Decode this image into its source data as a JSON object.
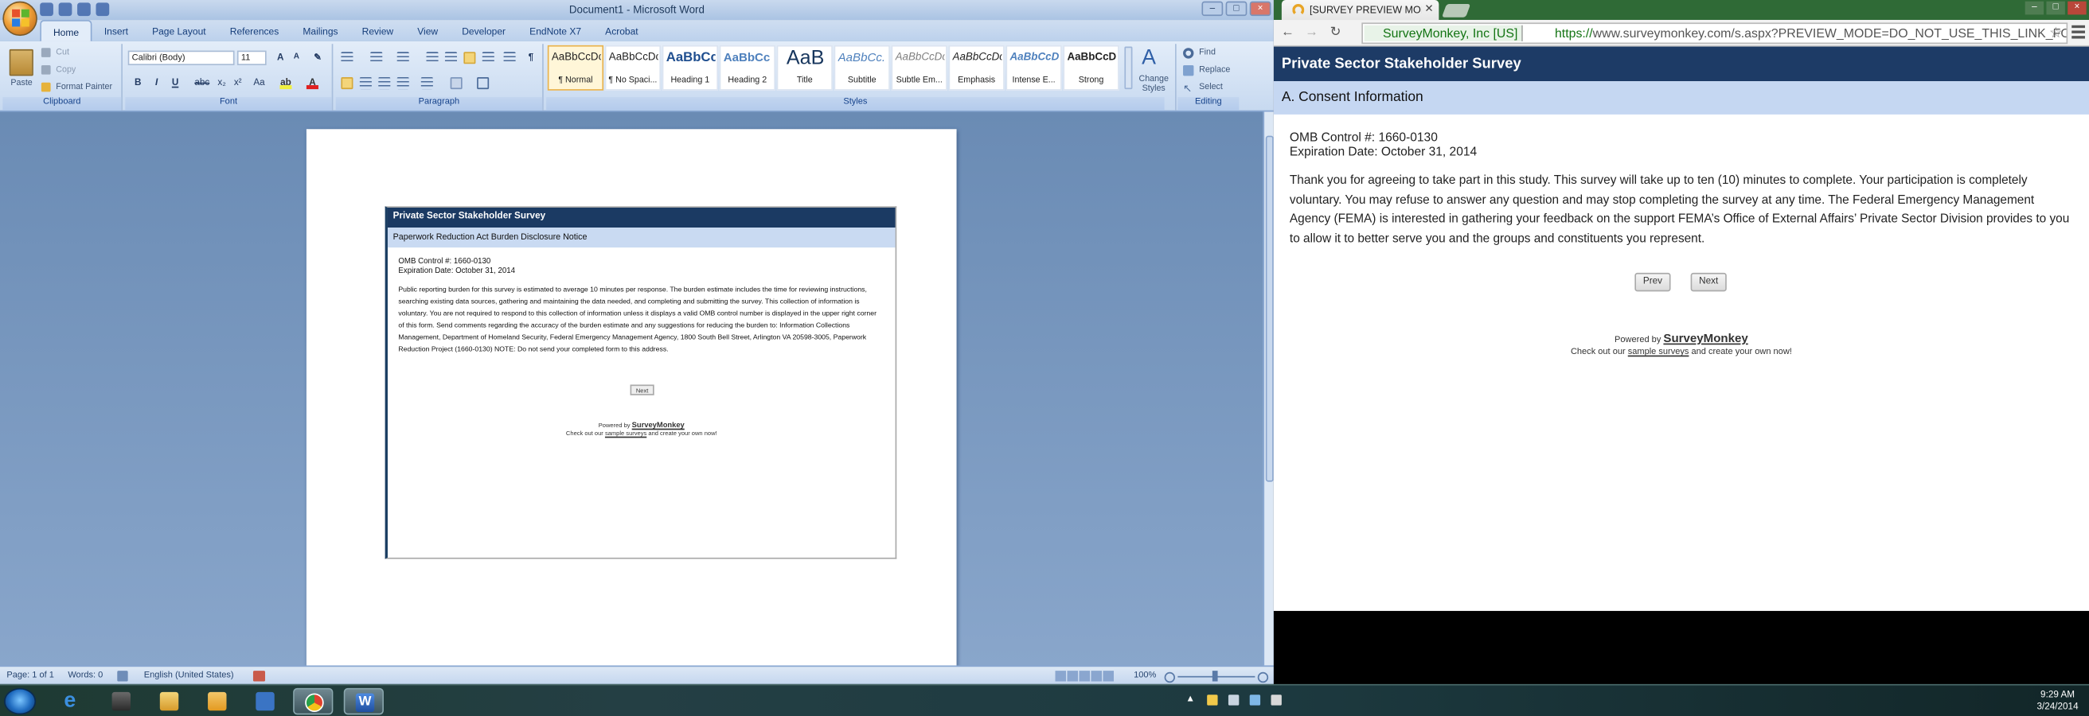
{
  "word": {
    "window_title": "Document1 - Microsoft Word",
    "tabs": [
      "Home",
      "Insert",
      "Page Layout",
      "References",
      "Mailings",
      "Review",
      "View",
      "Developer",
      "EndNote X7",
      "Acrobat"
    ],
    "clipboard": {
      "paste": "Paste",
      "cut": "Cut",
      "copy": "Copy",
      "format_painter": "Format Painter",
      "label": "Clipboard"
    },
    "font": {
      "name": "Calibri (Body)",
      "size": "11",
      "label": "Font"
    },
    "paragraph": {
      "label": "Paragraph"
    },
    "styles": {
      "label": "Styles",
      "items": [
        {
          "preview": "AaBbCcDc",
          "name": "¶ Normal"
        },
        {
          "preview": "AaBbCcDc",
          "name": "¶ No Spaci..."
        },
        {
          "preview": "AaBbCc",
          "name": "Heading 1"
        },
        {
          "preview": "AaBbCc",
          "name": "Heading 2"
        },
        {
          "preview": "AaB",
          "name": "Title"
        },
        {
          "preview": "AaBbCc.",
          "name": "Subtitle"
        },
        {
          "preview": "AaBbCcDc",
          "name": "Subtle Em..."
        },
        {
          "preview": "AaBbCcDc",
          "name": "Emphasis"
        },
        {
          "preview": "AaBbCcDc",
          "name": "Intense E..."
        },
        {
          "preview": "AaBbCcDc",
          "name": "Strong"
        }
      ],
      "change_styles": "Change Styles"
    },
    "editing": {
      "find": "Find",
      "replace": "Replace",
      "select": "Select",
      "label": "Editing"
    },
    "status": {
      "page": "Page: 1 of 1",
      "words": "Words: 0",
      "language": "English (United States)",
      "zoom": "100%"
    },
    "doc_image": {
      "header": "Private Sector Stakeholder Survey",
      "subheader": "Paperwork Reduction Act Burden Disclosure Notice",
      "omb": "OMB Control #: 1660-0130",
      "expiration": "Expiration Date: October 31, 2014",
      "paragraph": "Public reporting burden for this survey is estimated to average 10 minutes per response. The burden estimate includes the time for reviewing instructions, searching existing data sources, gathering and maintaining the data needed, and completing and submitting the survey. This collection of information is voluntary. You are not required to respond to this collection of information unless it displays a valid OMB control number is displayed in the upper right corner of this form. Send comments regarding the accuracy of the burden estimate and any suggestions for reducing the burden to: Information Collections Management, Department of Homeland Security, Federal Emergency Management Agency, 1800 South Bell Street, Arlington VA 20598-3005, Paperwork Reduction Project (1660-0130) NOTE: Do not send your completed form to this address.",
      "next": "Next",
      "powered_by": "Powered by",
      "brand": "SurveyMonkey",
      "check_prefix": "Check out our",
      "check_link": "sample surveys",
      "check_suffix": "and create your own now!"
    }
  },
  "chrome": {
    "tab_title": "[SURVEY PREVIEW MODE] Private Sector",
    "ev_label": "SurveyMonkey, Inc [US]",
    "url_scheme": "https://",
    "url_rest": "www.surveymonkey.com/s.aspx?PREVIEW_MODE=DO_NOT_USE_THIS_LINK_FOR_COLLECTION",
    "survey": {
      "title": "Private Sector Stakeholder Survey",
      "section": "A. Consent Information",
      "omb": "OMB Control #: 1660-0130",
      "expiration": "Expiration Date: October 31, 2014",
      "body": "Thank you for agreeing to take part in this study. This survey will take up to ten (10) minutes to complete. Your participation is completely voluntary. You may refuse to answer any question and may stop completing the survey at any time. The Federal Emergency Management Agency (FEMA) is interested in gathering your feedback on the support FEMA’s Office of External Affairs’ Private Sector Division provides to you to allow it to better serve you and the groups and constituents you represent.",
      "prev": "Prev",
      "next": "Next",
      "powered_by": "Powered by",
      "brand": "SurveyMonkey",
      "check_prefix": "Check out our",
      "check_link": "sample surveys",
      "check_suffix": "and create your own now!"
    }
  },
  "taskbar": {
    "time": "9:29 AM",
    "date": "3/24/2014"
  }
}
